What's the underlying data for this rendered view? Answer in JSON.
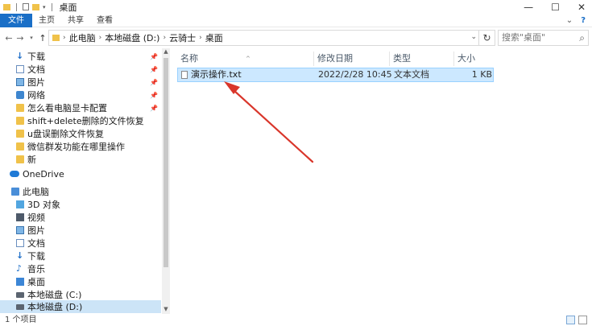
{
  "window": {
    "title": "桌面",
    "minimize": "—",
    "maximize": "☐",
    "close": "✕"
  },
  "ribbon": {
    "tabs": [
      "文件",
      "主页",
      "共享",
      "查看"
    ],
    "help": "?"
  },
  "address": {
    "crumbs": [
      "此电脑",
      "本地磁盘 (D:)",
      "云骑士",
      "桌面"
    ],
    "search_placeholder": "搜索\"桌面\""
  },
  "sidebar": {
    "quick_access": [
      {
        "label": "下载",
        "icon": "download-icon",
        "pinned": true
      },
      {
        "label": "文档",
        "icon": "document-icon",
        "pinned": true
      },
      {
        "label": "图片",
        "icon": "picture-icon",
        "pinned": true
      },
      {
        "label": "网络",
        "icon": "network-icon",
        "pinned": true
      },
      {
        "label": "怎么看电脑显卡配置",
        "icon": "folder-icon",
        "pinned": true
      },
      {
        "label": "shift+delete删除的文件恢复",
        "icon": "folder-icon",
        "pinned": false
      },
      {
        "label": "u盘误删除文件恢复",
        "icon": "folder-icon",
        "pinned": false
      },
      {
        "label": "微信群发功能在哪里操作",
        "icon": "folder-icon",
        "pinned": false
      },
      {
        "label": "新",
        "icon": "folder-icon",
        "pinned": false
      }
    ],
    "onedrive": "OneDrive",
    "this_pc": "此电脑",
    "pc_items": [
      {
        "label": "3D 对象",
        "icon": "cube-icon"
      },
      {
        "label": "视频",
        "icon": "video-icon"
      },
      {
        "label": "图片",
        "icon": "picture-icon"
      },
      {
        "label": "文档",
        "icon": "document-icon"
      },
      {
        "label": "下载",
        "icon": "download-icon"
      },
      {
        "label": "音乐",
        "icon": "music-icon"
      },
      {
        "label": "桌面",
        "icon": "desktop-icon"
      },
      {
        "label": "本地磁盘 (C:)",
        "icon": "drive-icon"
      },
      {
        "label": "本地磁盘 (D:)",
        "icon": "drive-icon",
        "selected": true
      }
    ]
  },
  "columns": {
    "name": "名称",
    "modified": "修改日期",
    "type": "类型",
    "size": "大小"
  },
  "files": [
    {
      "name": "演示操作.txt",
      "modified": "2022/2/28 10:45",
      "type": "文本文档",
      "size": "1 KB"
    }
  ],
  "status": {
    "count": "1 个项目"
  },
  "colors": {
    "file_tab": "#1a6fc7",
    "selection": "#cce8ff",
    "arrow": "#d9362b"
  }
}
